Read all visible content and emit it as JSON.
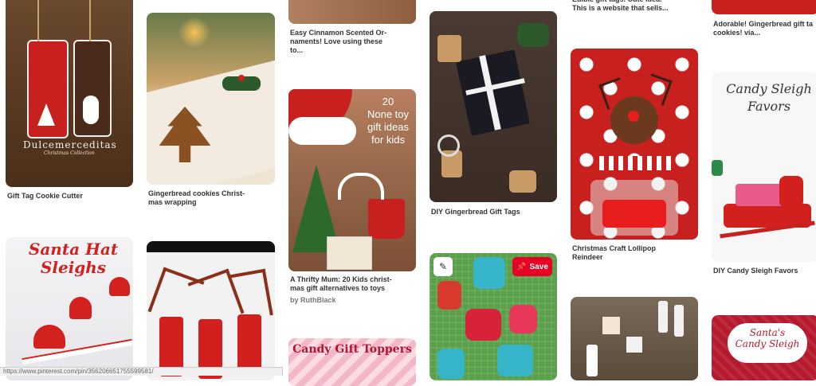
{
  "pins": [
    {
      "id": "gift-tag",
      "caption": "Gift Tag Cookie Cutter",
      "overlay": "Dulcemerceditas",
      "overlay2": "Christmas Collection"
    },
    {
      "id": "gingerbread-wrap",
      "caption": "Gingerbread cookies Christ-\nmas wrapping"
    },
    {
      "id": "cinnamon",
      "caption": "Easy Cinnamon Scented Or-\nnaments! Love using these\nto..."
    },
    {
      "id": "thrifty",
      "caption": "A Thrifty Mum: 20 Kids christ-\nmas gift alternatives to toys",
      "sub": "by RuthBlack",
      "overlay": "20\nNone toy\ngift ideas\nfor kids"
    },
    {
      "id": "diy-tags",
      "caption": "DIY Gingerbread Gift Tags"
    },
    {
      "id": "edible",
      "caption": "Edible gift tags. Cute idea.\nThis is a website that sells..."
    },
    {
      "id": "lollipop",
      "caption": "Christmas Craft Lollipop\nReindeer"
    },
    {
      "id": "adorable",
      "caption": "Adorable! Gingerbread gift ta\ncookies! via..."
    },
    {
      "id": "sleigh-favors",
      "caption": "DIY Candy Sleigh Favors",
      "overlay": "Candy Sleigh\nFavors"
    },
    {
      "id": "santa-hat",
      "overlay": "Santa Hat\nSleighs"
    },
    {
      "id": "reindeer-pipe"
    },
    {
      "id": "candy-toppers",
      "overlay": "Candy Gift Toppers"
    },
    {
      "id": "mittens"
    },
    {
      "id": "marshmallow"
    },
    {
      "id": "santas-sleigh",
      "overlay": "Santa's\nCandy Sleigh"
    }
  ],
  "buttons": {
    "save": "Save"
  },
  "status_text": "https://www.pinterest.com/pin/356206651755599581/"
}
